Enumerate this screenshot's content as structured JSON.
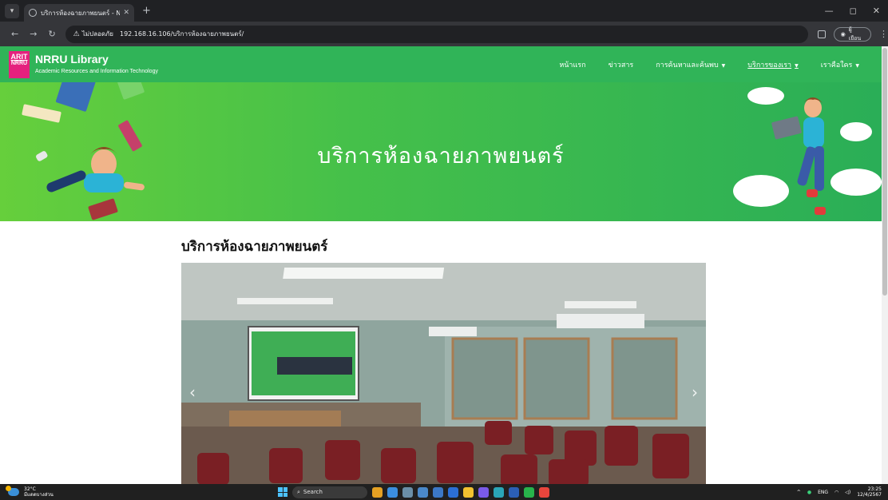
{
  "browser": {
    "tab_title": "บริการห้องฉายภาพยนตร์ - NRRU L",
    "new_tab": "+",
    "security_label": "ไม่ปลอดภัย",
    "url": "192.168.16.106/บริการห้องฉายภาพยนตร์/",
    "profile_label": "ผู้เยือน"
  },
  "site": {
    "logo_line1": "ARIT",
    "logo_line2": "NRRU",
    "brand_name": "NRRU Library",
    "brand_subtitle": "Academic Resources and Information Technology",
    "nav": [
      {
        "label": "หน้าแรก",
        "dropdown": false,
        "active": false
      },
      {
        "label": "ข่าวสาร",
        "dropdown": false,
        "active": false
      },
      {
        "label": "การค้นหาและค้นพบ",
        "dropdown": true,
        "active": false
      },
      {
        "label": "บริการของเรา",
        "dropdown": true,
        "active": true
      },
      {
        "label": "เราคือใคร",
        "dropdown": true,
        "active": false
      }
    ],
    "dropdown_caret": "▼"
  },
  "hero": {
    "title": "บริการห้องฉายภาพยนตร์"
  },
  "content": {
    "title": "บริการห้องฉายภาพยนตร์",
    "carousel_prev": "‹",
    "carousel_next": "›"
  },
  "taskbar": {
    "temperature": "32°C",
    "weather_text": "มีแดดบางส่วน",
    "search_label": "Search",
    "language": "ENG",
    "time": "23:25",
    "date": "12/4/2567"
  },
  "colors": {
    "header_green": "#30b458",
    "logo_pink": "#e5217e"
  }
}
